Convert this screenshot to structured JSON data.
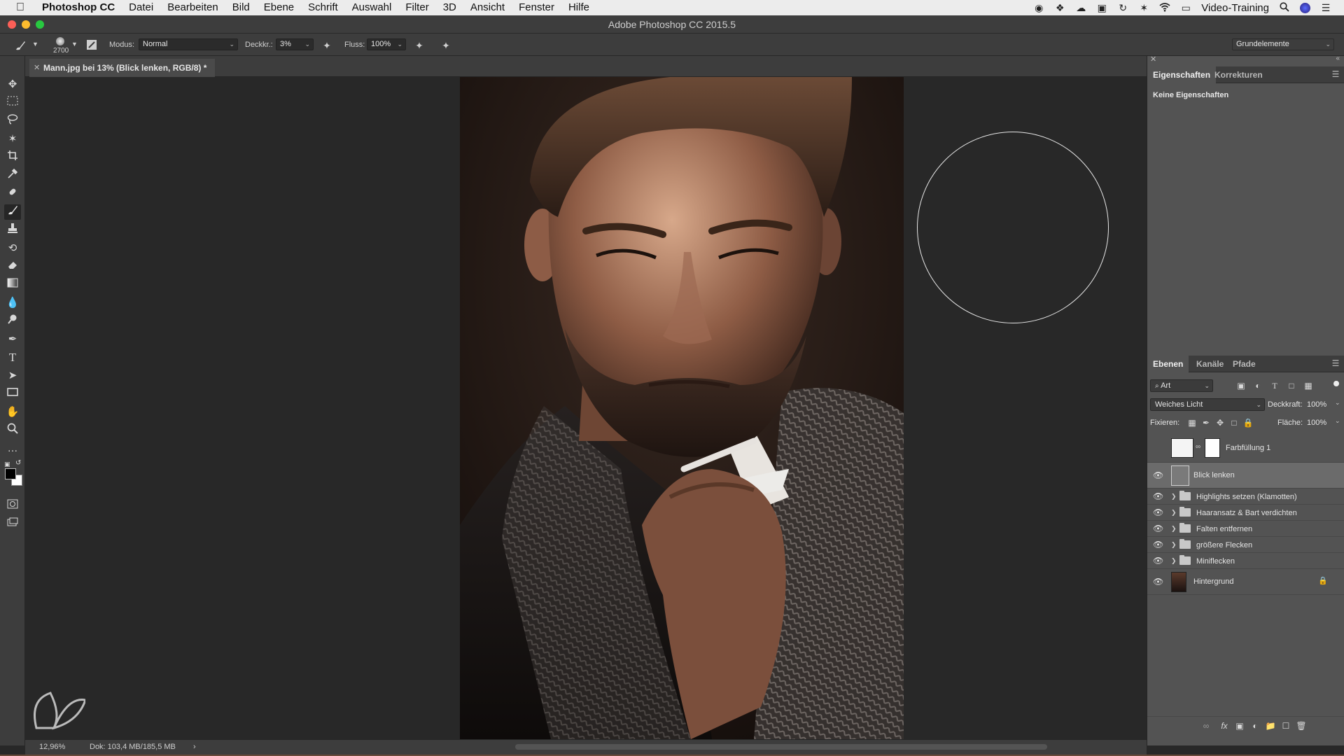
{
  "menubar": {
    "app_name": "Photoshop CC",
    "items": [
      "Datei",
      "Bearbeiten",
      "Bild",
      "Ebene",
      "Schrift",
      "Auswahl",
      "Filter",
      "3D",
      "Ansicht",
      "Fenster",
      "Hilfe"
    ],
    "user_label": "Video-Training"
  },
  "window": {
    "title": "Adobe Photoshop CC 2015.5"
  },
  "options": {
    "brush_size": "2700",
    "mode_label": "Modus:",
    "mode_value": "Normal",
    "opacity_label": "Deckkr.:",
    "opacity_value": "3%",
    "flow_label": "Fluss:",
    "flow_value": "100%",
    "workspace": "Grundelemente"
  },
  "document": {
    "tab_title": "Mann.jpg bei 13% (Blick lenken, RGB/8) *"
  },
  "status": {
    "zoom": "12,96%",
    "doc_size": "Dok: 103,4 MB/185,5 MB"
  },
  "properties_panel": {
    "tabs": [
      "Eigenschaften",
      "Korrekturen"
    ],
    "empty_text": "Keine Eigenschaften"
  },
  "layers_panel": {
    "tabs": [
      "Ebenen",
      "Kanäle",
      "Pfade"
    ],
    "filter_label": "Art",
    "blend_mode": "Weiches Licht",
    "opacity_label": "Deckkraft:",
    "opacity_value": "100%",
    "lock_label": "Fixieren:",
    "fill_label": "Fläche:",
    "fill_value": "100%",
    "layers": [
      {
        "name": "Farbfüllung 1",
        "type": "fill",
        "visible": false
      },
      {
        "name": "Blick lenken",
        "type": "layer",
        "visible": true,
        "selected": true
      },
      {
        "name": "Highlights setzen (Klamotten)",
        "type": "group",
        "visible": true
      },
      {
        "name": "Haaransatz & Bart verdichten",
        "type": "group",
        "visible": true
      },
      {
        "name": "Falten entfernen",
        "type": "group",
        "visible": true
      },
      {
        "name": "größere Flecken",
        "type": "group",
        "visible": true
      },
      {
        "name": "Miniflecken",
        "type": "group",
        "visible": true
      },
      {
        "name": "Hintergrund",
        "type": "background",
        "visible": true,
        "locked": true
      }
    ]
  },
  "colors": {
    "accent_selected": "#6b6b6b",
    "panel_bg": "#535353",
    "chrome_bg": "#3d3d3d",
    "canvas_bg": "#282828"
  }
}
